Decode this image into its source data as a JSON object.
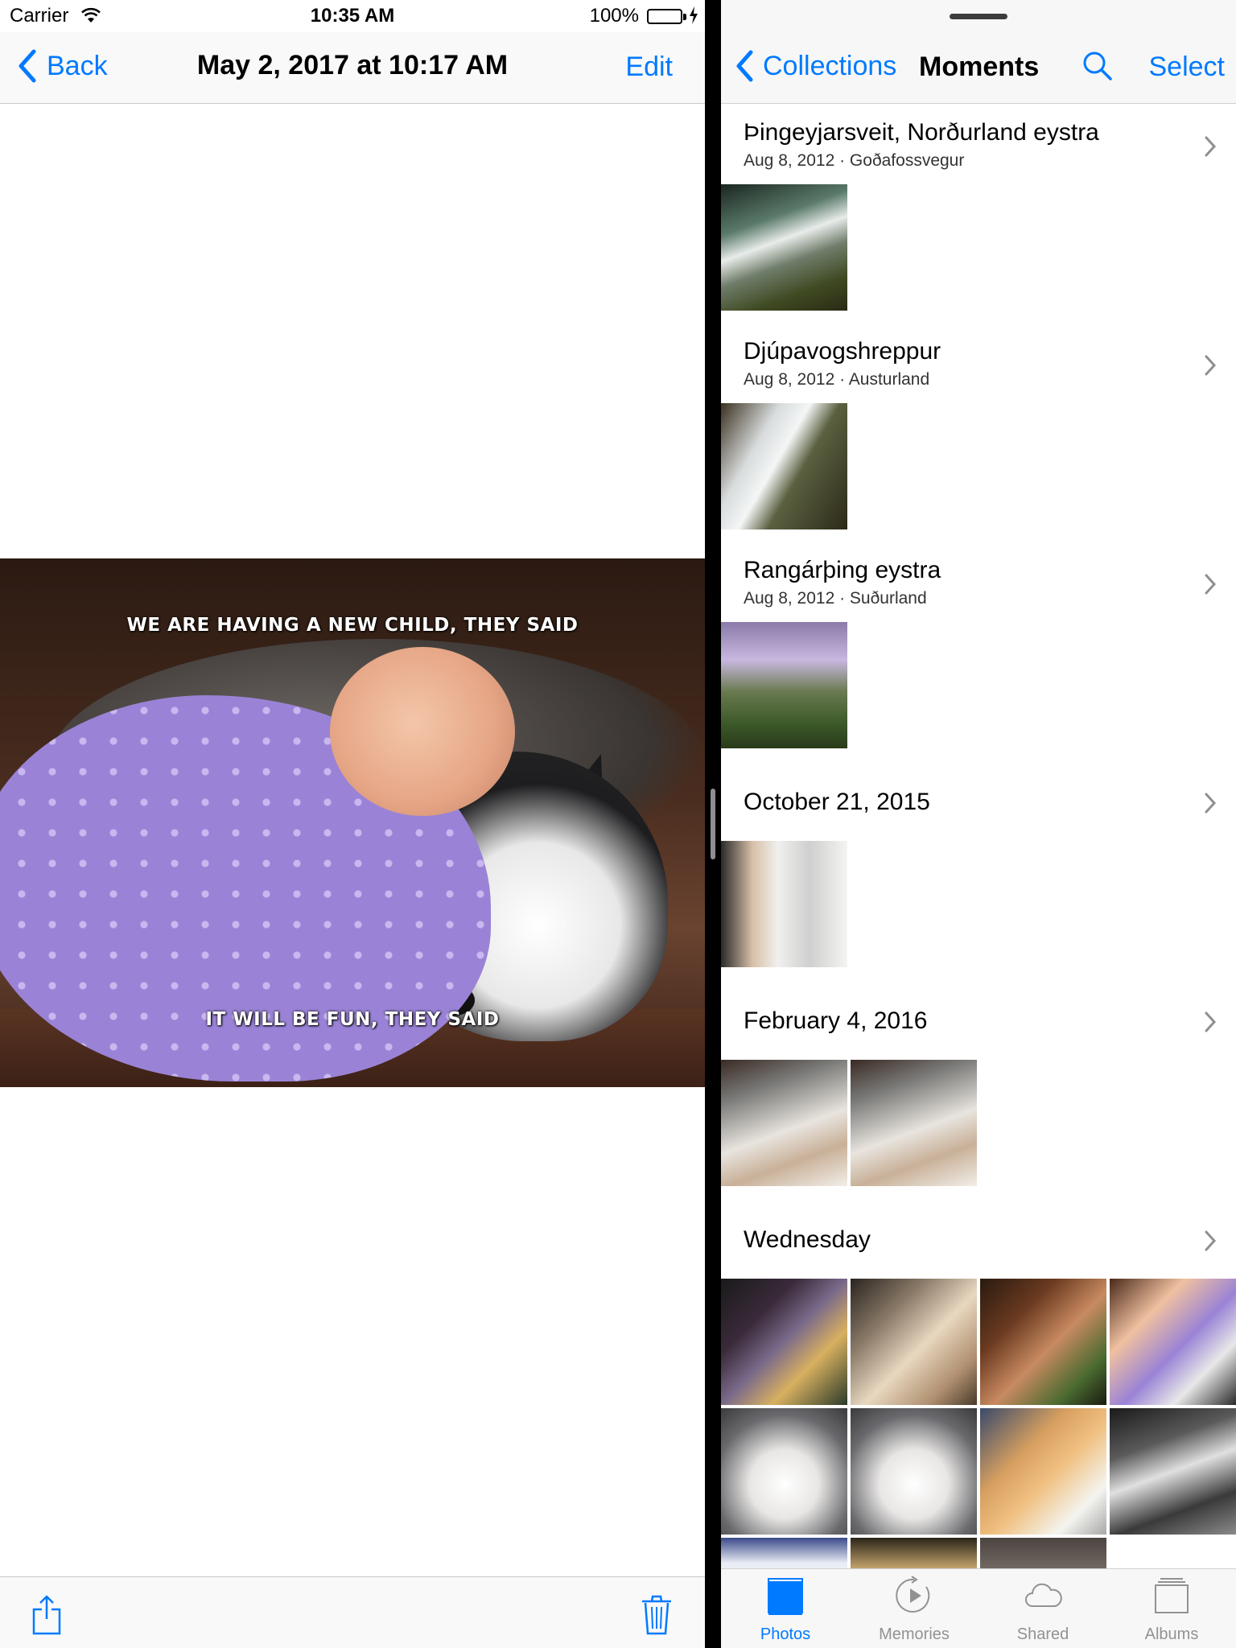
{
  "status_bar": {
    "carrier": "Carrier",
    "time": "10:35 AM",
    "battery": "100%",
    "battery_level": 1.0
  },
  "detail": {
    "back_label": "Back",
    "title": "May 2, 2017 at 10:17 AM",
    "edit_label": "Edit",
    "meme_top": "WE ARE HAVING A NEW CHILD, THEY SAID",
    "meme_bottom": "IT WILL BE FUN, THEY SAID",
    "toolbar_icons": [
      "share-icon",
      "trash-icon"
    ]
  },
  "moments_nav": {
    "back_label": "Collections",
    "title": "Moments",
    "search_icon": "search-icon",
    "select_label": "Select"
  },
  "moments": [
    {
      "title": "Þingeyjarsveit, Norðurland eystra",
      "date": "Aug 8, 2012",
      "place": "Goðafossvegur",
      "subtitle": "Aug 8, 2012 · Goðafossvegur",
      "photo_count": 1
    },
    {
      "title": "Djúpavogshreppur",
      "date": "Aug 8, 2012",
      "place": "Austurland",
      "subtitle": "Aug 8, 2012 · Austurland",
      "photo_count": 1
    },
    {
      "title": "Rangárþing eystra",
      "date": "Aug 8, 2012",
      "place": "Suðurland",
      "subtitle": "Aug 8, 2012 · Suðurland",
      "photo_count": 1
    },
    {
      "title": "October 21, 2015",
      "subtitle": "",
      "photo_count": 1
    },
    {
      "title": "February 4, 2016",
      "subtitle": "",
      "photo_count": 2
    },
    {
      "title": "Wednesday",
      "subtitle": "",
      "photo_count": 12
    }
  ],
  "tabs": [
    {
      "label": "Photos",
      "icon": "photos-icon",
      "active": true
    },
    {
      "label": "Memories",
      "icon": "memories-icon",
      "active": false
    },
    {
      "label": "Shared",
      "icon": "cloud-icon",
      "active": false
    },
    {
      "label": "Albums",
      "icon": "albums-icon",
      "active": false
    }
  ],
  "colors": {
    "accent": "#007aff",
    "battery": "#4cd964",
    "inactive_tab": "#929292"
  }
}
